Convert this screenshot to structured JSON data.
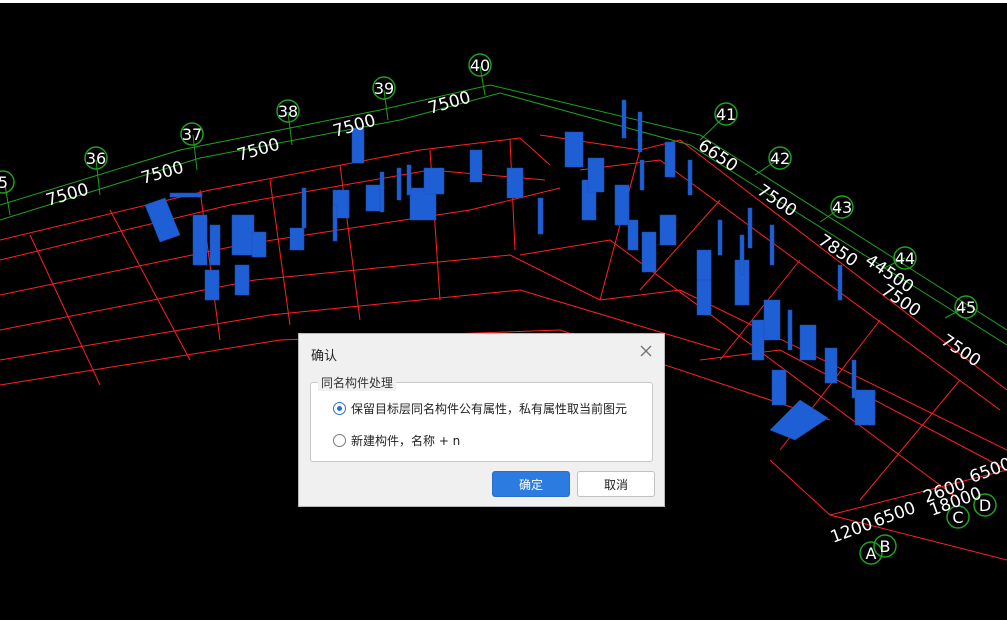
{
  "scene": {
    "axes_top": [
      "5",
      "36",
      "37",
      "38",
      "39",
      "40"
    ],
    "axes_right": [
      "41",
      "42",
      "43",
      "44",
      "45"
    ],
    "axes_bottom": [
      "A",
      "B",
      "C",
      "D"
    ],
    "dims_top": [
      "7500",
      "7500",
      "7500",
      "7500",
      "7500"
    ],
    "dims_right": [
      "6650",
      "7500",
      "7850",
      "44500",
      "7500",
      "7500"
    ],
    "dims_bottom": [
      "1200",
      "6500",
      "2600",
      "18000",
      "6500"
    ]
  },
  "colors": {
    "grid_red": "#ff2020",
    "grid_green": "#1fa01f",
    "component_blue": "#1f5fd6",
    "accent": "#2b7be0"
  },
  "dialog": {
    "title": "确认",
    "close_icon": "close-icon",
    "group_title": "同名构件处理",
    "options": [
      {
        "label": "保留目标层同名构件公有属性，私有属性取当前图元",
        "checked": true
      },
      {
        "label": "新建构件，名称 + n",
        "checked": false
      }
    ],
    "ok_label": "确定",
    "cancel_label": "取消"
  }
}
